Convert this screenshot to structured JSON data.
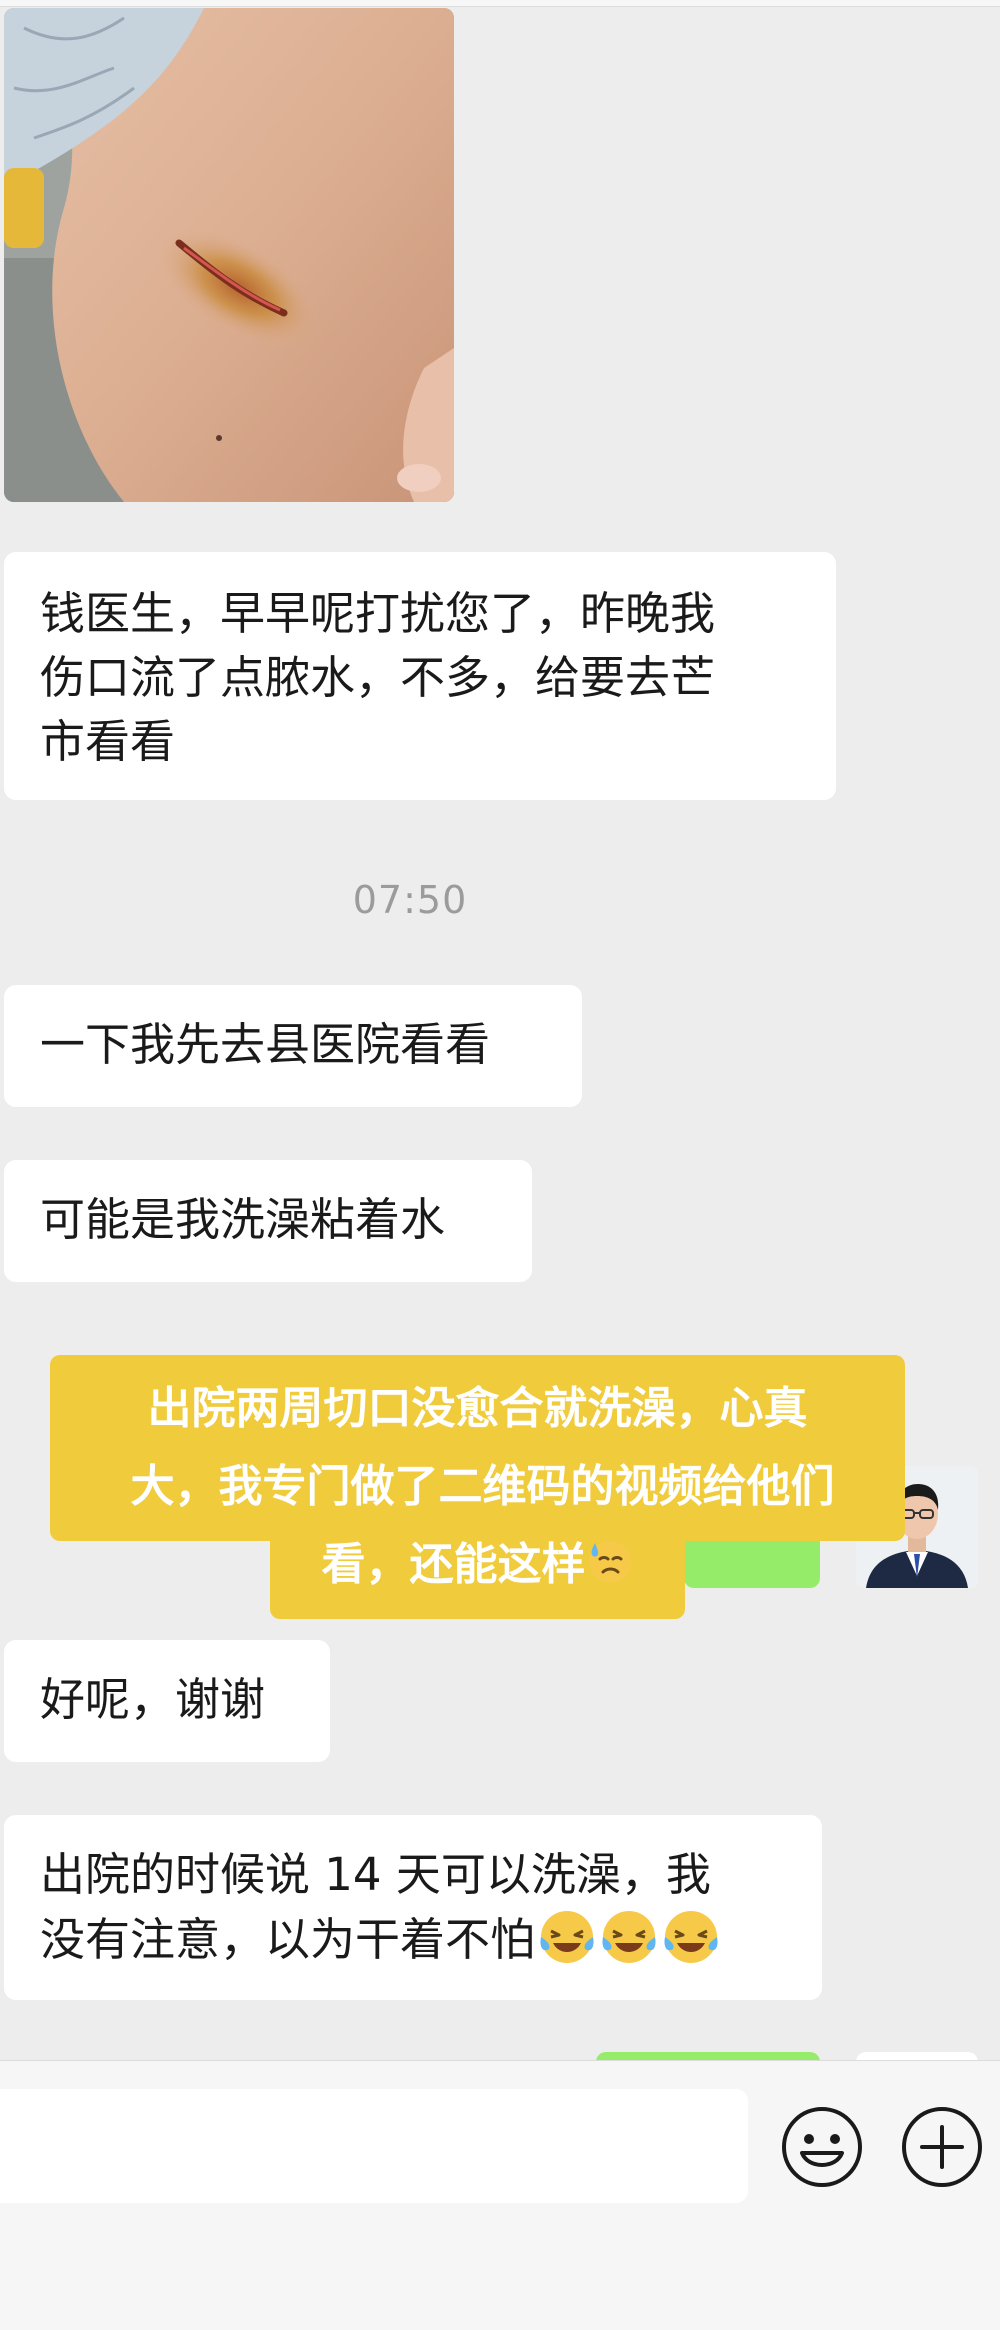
{
  "messages": [
    {
      "id": "m1",
      "text": "钱医生，早早呢打扰您了，昨晚我\n伤口流了点脓水，不多，给要去芒\n市看看"
    },
    {
      "id": "m2",
      "text": "一下我先去县医院看看"
    },
    {
      "id": "m3",
      "text": "可能是我洗澡粘着水"
    },
    {
      "id": "m4",
      "text": "好呢，谢谢"
    },
    {
      "id": "m5",
      "text_line1": "出院的时候说 14 天可以洗澡，我",
      "text_line2": "没有注意，以为干着不怕"
    }
  ],
  "timestamp": "07:50",
  "caption": {
    "line1": "出院两周切口没愈合就洗澡，心真",
    "line2": "大，我专门做了二维码的视频给他们",
    "line3": "看，还能这样",
    "emoji": "sweat-emoji"
  },
  "icons": {
    "emoji_button": "smiley-icon",
    "more_button": "plus-icon",
    "inline_emoji": "crying-laughing-emoji"
  },
  "colors": {
    "background": "#ededed",
    "incoming_bubble": "#ffffff",
    "outgoing_bubble": "#95ec69",
    "caption_background": "#f0cb3c",
    "timestamp": "#9b9b9b"
  }
}
